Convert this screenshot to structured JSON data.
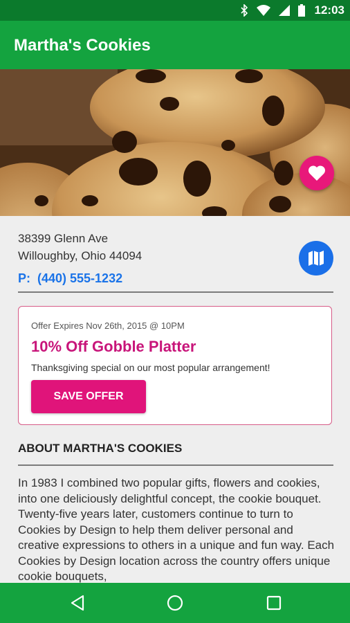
{
  "status_bar": {
    "time": "12:03",
    "icons": [
      "bluetooth-icon",
      "wifi-icon",
      "signal-icon",
      "battery-icon"
    ]
  },
  "app_bar": {
    "title": "Martha's Cookies"
  },
  "hero": {
    "image": "chocolate-chip-cookies-photo",
    "favorite_icon": "heart-icon"
  },
  "location": {
    "address_line1": "38399 Glenn Ave",
    "address_line2": "Willoughby, Ohio 44094",
    "phone_prefix": "P:",
    "phone": "(440) 555-1232",
    "map_icon": "map-icon"
  },
  "offer": {
    "expires": "Offer Expires Nov 26th, 2015 @ 10PM",
    "title": "10% Off Gobble Platter",
    "description": "Thanksgiving special on our most popular arrangement!",
    "button_label": "SAVE OFFER"
  },
  "about": {
    "heading": "ABOUT MARTHA'S COOKIES",
    "text": "In 1983 I combined two popular gifts, flowers and cookies, into one deliciously delightful concept, the cookie bouquet. Twenty-five years later, customers continue to turn to Cookies by Design to help them deliver personal and creative expressions to others in a unique and fun way. Each Cookies by Design location across the country offers unique cookie bouquets,"
  },
  "nav_bar": {
    "back_icon": "back-triangle-icon",
    "home_icon": "home-circle-icon",
    "recents_icon": "recents-square-icon"
  },
  "colors": {
    "primary": "#14a33f",
    "primary_dark": "#0b7a2c",
    "accent": "#e0147a",
    "link": "#1a73e8"
  }
}
